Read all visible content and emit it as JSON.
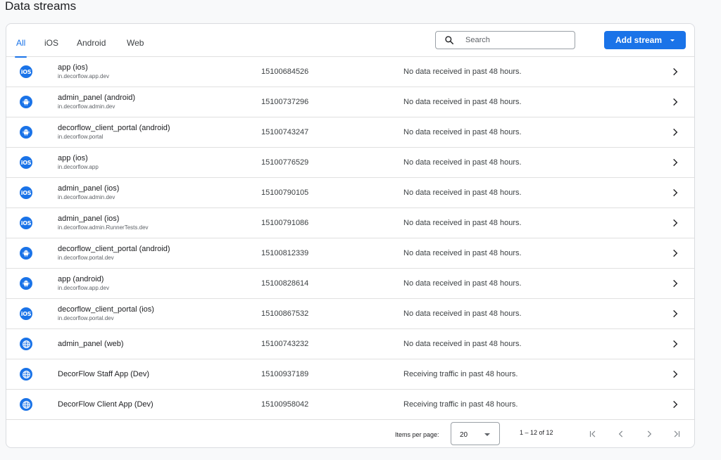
{
  "page": {
    "title": "Data streams"
  },
  "tabs": [
    {
      "label": "All",
      "active": true
    },
    {
      "label": "iOS",
      "active": false
    },
    {
      "label": "Android",
      "active": false
    },
    {
      "label": "Web",
      "active": false
    }
  ],
  "search": {
    "placeholder": "Search",
    "value": "",
    "icon": "search-icon"
  },
  "add_stream": {
    "label": "Add stream",
    "icon": "caret-down-icon"
  },
  "colors": {
    "accent": "#1a73e8",
    "border": "#dadce0",
    "text": "#202124",
    "muted": "#5f6368"
  },
  "streams": [
    {
      "platform": "ios",
      "icon": "ios-icon",
      "name": "app (ios)",
      "sub": "in.decorflow.app.dev",
      "id": "15100684526",
      "status": "No data received in past 48 hours."
    },
    {
      "platform": "android",
      "icon": "android-icon",
      "name": "admin_panel (android)",
      "sub": "in.decorflow.admin.dev",
      "id": "15100737296",
      "status": "No data received in past 48 hours."
    },
    {
      "platform": "android",
      "icon": "android-icon",
      "name": "decorflow_client_portal (android)",
      "sub": "in.decorflow.portal",
      "id": "15100743247",
      "status": "No data received in past 48 hours."
    },
    {
      "platform": "ios",
      "icon": "ios-icon",
      "name": "app (ios)",
      "sub": "in.decorflow.app",
      "id": "15100776529",
      "status": "No data received in past 48 hours."
    },
    {
      "platform": "ios",
      "icon": "ios-icon",
      "name": "admin_panel (ios)",
      "sub": "in.decorflow.admin.dev",
      "id": "15100790105",
      "status": "No data received in past 48 hours."
    },
    {
      "platform": "ios",
      "icon": "ios-icon",
      "name": "admin_panel (ios)",
      "sub": "in.decorflow.admin.RunnerTests.dev",
      "id": "15100791086",
      "status": "No data received in past 48 hours."
    },
    {
      "platform": "android",
      "icon": "android-icon",
      "name": "decorflow_client_portal (android)",
      "sub": "in.decorflow.portal.dev",
      "id": "15100812339",
      "status": "No data received in past 48 hours."
    },
    {
      "platform": "android",
      "icon": "android-icon",
      "name": "app (android)",
      "sub": "in.decorflow.app.dev",
      "id": "15100828614",
      "status": "No data received in past 48 hours."
    },
    {
      "platform": "ios",
      "icon": "ios-icon",
      "name": "decorflow_client_portal (ios)",
      "sub": "in.decorflow.portal.dev",
      "id": "15100867532",
      "status": "No data received in past 48 hours."
    },
    {
      "platform": "web",
      "icon": "globe-icon",
      "name": "admin_panel (web)",
      "sub": "",
      "id": "15100743232",
      "status": "No data received in past 48 hours."
    },
    {
      "platform": "web",
      "icon": "globe-icon",
      "name": "DecorFlow Staff App (Dev)",
      "sub": "",
      "id": "15100937189",
      "status": "Receiving traffic in past 48 hours."
    },
    {
      "platform": "web",
      "icon": "globe-icon",
      "name": "DecorFlow Client App (Dev)",
      "sub": "",
      "id": "15100958042",
      "status": "Receiving traffic in past 48 hours."
    }
  ],
  "pagination": {
    "items_per_page_label": "Items per page:",
    "items_per_page_value": "20",
    "range_label": "1 – 12 of 12",
    "icons": [
      "first-page-icon",
      "previous-page-icon",
      "next-page-icon",
      "last-page-icon"
    ]
  }
}
